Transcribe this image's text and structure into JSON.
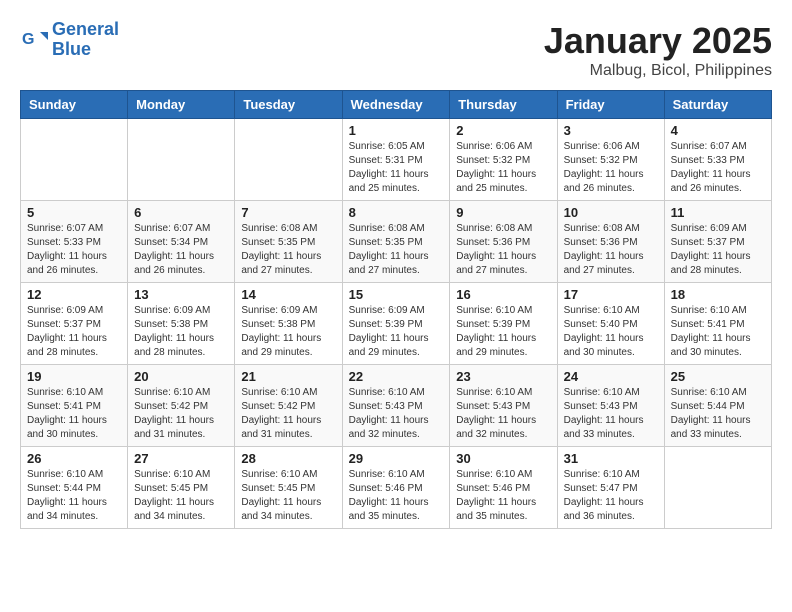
{
  "logo": {
    "line1": "General",
    "line2": "Blue"
  },
  "title": "January 2025",
  "location": "Malbug, Bicol, Philippines",
  "days_of_week": [
    "Sunday",
    "Monday",
    "Tuesday",
    "Wednesday",
    "Thursday",
    "Friday",
    "Saturday"
  ],
  "weeks": [
    [
      {
        "day": "",
        "info": ""
      },
      {
        "day": "",
        "info": ""
      },
      {
        "day": "",
        "info": ""
      },
      {
        "day": "1",
        "info": "Sunrise: 6:05 AM\nSunset: 5:31 PM\nDaylight: 11 hours\nand 25 minutes."
      },
      {
        "day": "2",
        "info": "Sunrise: 6:06 AM\nSunset: 5:32 PM\nDaylight: 11 hours\nand 25 minutes."
      },
      {
        "day": "3",
        "info": "Sunrise: 6:06 AM\nSunset: 5:32 PM\nDaylight: 11 hours\nand 26 minutes."
      },
      {
        "day": "4",
        "info": "Sunrise: 6:07 AM\nSunset: 5:33 PM\nDaylight: 11 hours\nand 26 minutes."
      }
    ],
    [
      {
        "day": "5",
        "info": "Sunrise: 6:07 AM\nSunset: 5:33 PM\nDaylight: 11 hours\nand 26 minutes."
      },
      {
        "day": "6",
        "info": "Sunrise: 6:07 AM\nSunset: 5:34 PM\nDaylight: 11 hours\nand 26 minutes."
      },
      {
        "day": "7",
        "info": "Sunrise: 6:08 AM\nSunset: 5:35 PM\nDaylight: 11 hours\nand 27 minutes."
      },
      {
        "day": "8",
        "info": "Sunrise: 6:08 AM\nSunset: 5:35 PM\nDaylight: 11 hours\nand 27 minutes."
      },
      {
        "day": "9",
        "info": "Sunrise: 6:08 AM\nSunset: 5:36 PM\nDaylight: 11 hours\nand 27 minutes."
      },
      {
        "day": "10",
        "info": "Sunrise: 6:08 AM\nSunset: 5:36 PM\nDaylight: 11 hours\nand 27 minutes."
      },
      {
        "day": "11",
        "info": "Sunrise: 6:09 AM\nSunset: 5:37 PM\nDaylight: 11 hours\nand 28 minutes."
      }
    ],
    [
      {
        "day": "12",
        "info": "Sunrise: 6:09 AM\nSunset: 5:37 PM\nDaylight: 11 hours\nand 28 minutes."
      },
      {
        "day": "13",
        "info": "Sunrise: 6:09 AM\nSunset: 5:38 PM\nDaylight: 11 hours\nand 28 minutes."
      },
      {
        "day": "14",
        "info": "Sunrise: 6:09 AM\nSunset: 5:38 PM\nDaylight: 11 hours\nand 29 minutes."
      },
      {
        "day": "15",
        "info": "Sunrise: 6:09 AM\nSunset: 5:39 PM\nDaylight: 11 hours\nand 29 minutes."
      },
      {
        "day": "16",
        "info": "Sunrise: 6:10 AM\nSunset: 5:39 PM\nDaylight: 11 hours\nand 29 minutes."
      },
      {
        "day": "17",
        "info": "Sunrise: 6:10 AM\nSunset: 5:40 PM\nDaylight: 11 hours\nand 30 minutes."
      },
      {
        "day": "18",
        "info": "Sunrise: 6:10 AM\nSunset: 5:41 PM\nDaylight: 11 hours\nand 30 minutes."
      }
    ],
    [
      {
        "day": "19",
        "info": "Sunrise: 6:10 AM\nSunset: 5:41 PM\nDaylight: 11 hours\nand 30 minutes."
      },
      {
        "day": "20",
        "info": "Sunrise: 6:10 AM\nSunset: 5:42 PM\nDaylight: 11 hours\nand 31 minutes."
      },
      {
        "day": "21",
        "info": "Sunrise: 6:10 AM\nSunset: 5:42 PM\nDaylight: 11 hours\nand 31 minutes."
      },
      {
        "day": "22",
        "info": "Sunrise: 6:10 AM\nSunset: 5:43 PM\nDaylight: 11 hours\nand 32 minutes."
      },
      {
        "day": "23",
        "info": "Sunrise: 6:10 AM\nSunset: 5:43 PM\nDaylight: 11 hours\nand 32 minutes."
      },
      {
        "day": "24",
        "info": "Sunrise: 6:10 AM\nSunset: 5:43 PM\nDaylight: 11 hours\nand 33 minutes."
      },
      {
        "day": "25",
        "info": "Sunrise: 6:10 AM\nSunset: 5:44 PM\nDaylight: 11 hours\nand 33 minutes."
      }
    ],
    [
      {
        "day": "26",
        "info": "Sunrise: 6:10 AM\nSunset: 5:44 PM\nDaylight: 11 hours\nand 34 minutes."
      },
      {
        "day": "27",
        "info": "Sunrise: 6:10 AM\nSunset: 5:45 PM\nDaylight: 11 hours\nand 34 minutes."
      },
      {
        "day": "28",
        "info": "Sunrise: 6:10 AM\nSunset: 5:45 PM\nDaylight: 11 hours\nand 34 minutes."
      },
      {
        "day": "29",
        "info": "Sunrise: 6:10 AM\nSunset: 5:46 PM\nDaylight: 11 hours\nand 35 minutes."
      },
      {
        "day": "30",
        "info": "Sunrise: 6:10 AM\nSunset: 5:46 PM\nDaylight: 11 hours\nand 35 minutes."
      },
      {
        "day": "31",
        "info": "Sunrise: 6:10 AM\nSunset: 5:47 PM\nDaylight: 11 hours\nand 36 minutes."
      },
      {
        "day": "",
        "info": ""
      }
    ]
  ]
}
